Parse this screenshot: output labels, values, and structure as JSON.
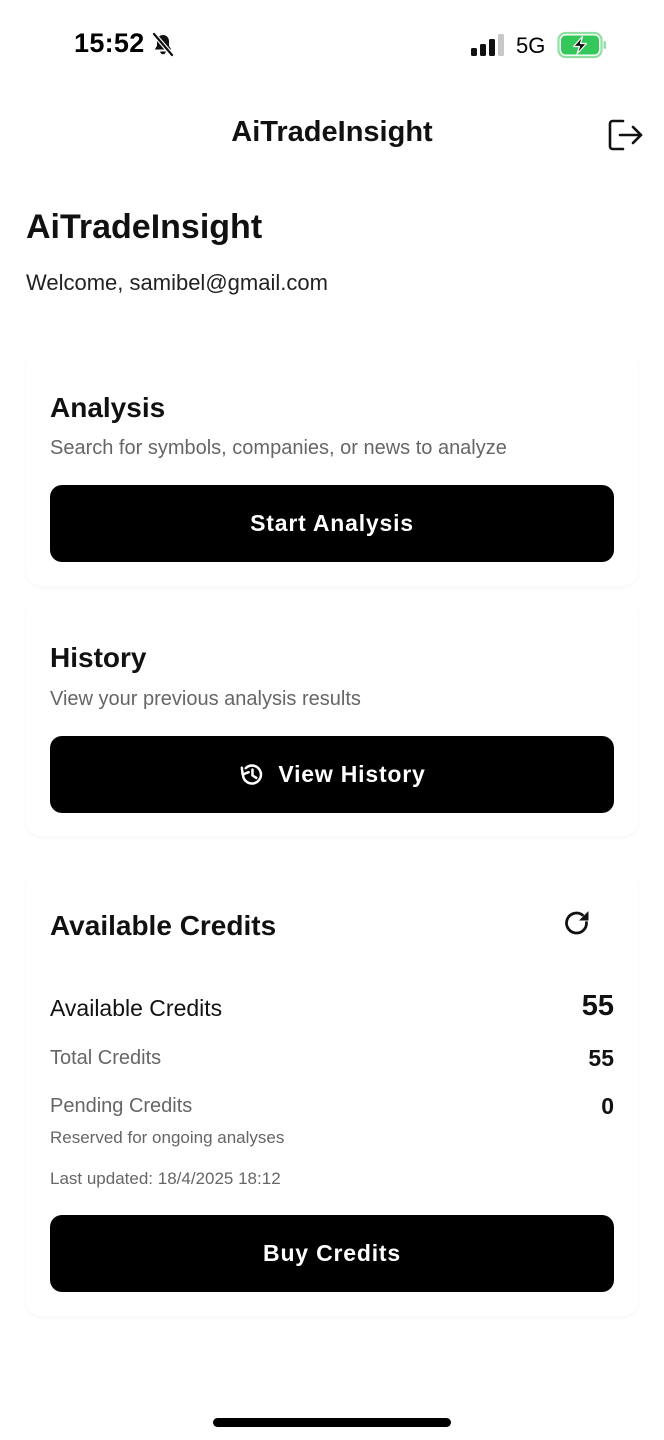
{
  "status_bar": {
    "time": "15:52",
    "network": "5G",
    "icons": [
      "bell-slash-icon",
      "signal-icon",
      "battery-charging-icon"
    ],
    "battery_color": "#34c759"
  },
  "app_bar": {
    "title": "AiTradeInsight",
    "logout_icon": "logout-icon"
  },
  "header": {
    "title": "AiTradeInsight",
    "welcome": "Welcome, samibel@gmail.com"
  },
  "analysis_card": {
    "title": "Analysis",
    "subtitle": "Search for symbols, companies, or news to analyze",
    "button_label": "Start Analysis"
  },
  "history_card": {
    "title": "History",
    "subtitle": "View your previous analysis results",
    "button_label": "View History",
    "button_icon": "history-icon"
  },
  "credits_card": {
    "title": "Available Credits",
    "refresh_icon": "refresh-icon",
    "available_label": "Available Credits",
    "available_value": "55",
    "total_label": "Total Credits",
    "total_value": "55",
    "pending_label": "Pending Credits",
    "pending_value": "0",
    "pending_note": "Reserved for ongoing analyses",
    "last_updated": "Last updated: 18/4/2025 18:12",
    "button_label": "Buy Credits"
  },
  "colors": {
    "button_bg": "#000000",
    "button_text": "#ffffff",
    "subtitle_text": "#666666"
  }
}
